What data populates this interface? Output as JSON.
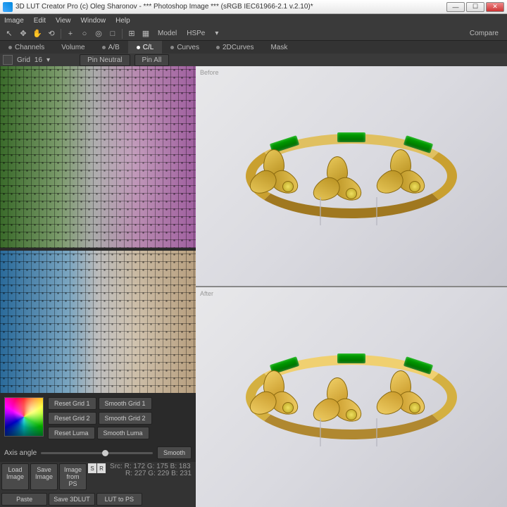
{
  "title": "3D LUT Creator Pro (c) Oleg Sharonov - *** Photoshop Image *** (sRGB IEC61966-2.1 v.2.10)*",
  "menu": {
    "image": "Image",
    "edit": "Edit",
    "view": "View",
    "window": "Window",
    "help": "Help"
  },
  "toolbar": {
    "model": "Model",
    "hsp": "HSPe",
    "compare": "Compare"
  },
  "tabs": {
    "channels": "Channels",
    "volume": "Volume",
    "ab": "A/B",
    "cl": "C/L",
    "curves": "Curves",
    "curves2d": "2DCurves",
    "mask": "Mask"
  },
  "sub": {
    "grid": "Grid",
    "gridval": "16",
    "pinneutral": "Pin Neutral",
    "pinall": "Pin All"
  },
  "buttons": {
    "resetg1": "Reset Grid 1",
    "smoothg1": "Smooth Grid 1",
    "resetg2": "Reset Grid 2",
    "smoothg2": "Smooth Grid 2",
    "resetluma": "Reset Luma",
    "smoothluma": "Smooth Luma",
    "axis": "Axis angle",
    "smooth": "Smooth",
    "loadimg": "Load Image",
    "saveimg": "Save Image",
    "imgfromps": "Image from PS",
    "paste": "Paste",
    "save3dlut": "Save 3DLUT",
    "luttops": "LUT to PS",
    "s": "S",
    "r": "R"
  },
  "readout": {
    "src": "Src:",
    "l1": "R: 172   G: 175   B: 183",
    "l2": "R: 227   G: 229   B: 231"
  },
  "preview": {
    "before": "Before",
    "after": "After"
  }
}
